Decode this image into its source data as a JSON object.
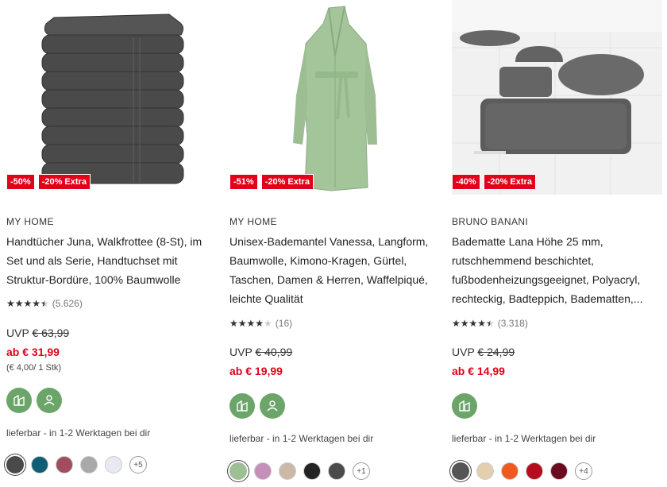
{
  "products": [
    {
      "badges": [
        "-50%",
        "-20% Extra"
      ],
      "brand": "MY HOME",
      "title": "Handtücher Juna, Walkfrottee (8-St), im Set und als Serie, Handtuchset mit Struktur-Bordüre, 100% Baumwolle",
      "rating": 4.5,
      "rating_count": "(5.626)",
      "uvp_label": "UVP",
      "uvp_price": "€ 63,99",
      "price": "ab € 31,99",
      "unit_price": "(€ 4,00/ 1 Stk)",
      "features": [
        "feature-icon-sustainable",
        "feature-icon-certified"
      ],
      "delivery": "lieferbar - in 1-2 Werktagen bei dir",
      "colors": [
        "#4a4a4a",
        "#0f5e74",
        "#a24c62",
        "#a9a9a9",
        "#e8eaf1"
      ],
      "more_colors": "+5"
    },
    {
      "badges": [
        "-51%",
        "-20% Extra"
      ],
      "brand": "MY HOME",
      "title": "Unisex-Bademantel Vanessa, Langform, Baumwolle, Kimono-Kragen, Gürtel, Taschen, Damen & Herren, Waffelpiqué, leichte Qualität",
      "rating": 4.0,
      "rating_count": "(16)",
      "uvp_label": "UVP",
      "uvp_price": "€ 40,99",
      "price": "ab € 19,99",
      "unit_price": "",
      "features": [
        "feature-icon-sustainable",
        "feature-icon-certified"
      ],
      "delivery": "lieferbar - in 1-2 Werktagen bei dir",
      "colors": [
        "#9dbf96",
        "#c48fb8",
        "#ccb8a6",
        "#222222",
        "#4b4b4b"
      ],
      "more_colors": "+1"
    },
    {
      "badges": [
        "-40%",
        "-20% Extra"
      ],
      "brand": "BRUNO BANANI",
      "title": "Badematte Lana Höhe 25 mm, rutschhemmend beschichtet, fußbodenheizungsgeeignet, Polyacryl, rechteckig, Badteppich, Badematten,...",
      "rating": 4.5,
      "rating_count": "(3.318)",
      "uvp_label": "UVP",
      "uvp_price": "€ 24,99",
      "price": "ab € 14,99",
      "unit_price": "",
      "features": [
        "feature-icon-sustainable"
      ],
      "delivery": "lieferbar - in 1-2 Werktagen bei dir",
      "colors": [
        "#555555",
        "#e3ceb0",
        "#f05a1e",
        "#b30d1e",
        "#6b0c1e"
      ],
      "more_colors": "+4"
    }
  ]
}
